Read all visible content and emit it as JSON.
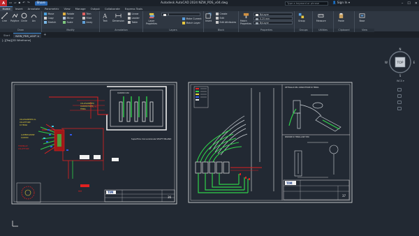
{
  "window": {
    "title": "Autodesk AutoCAD 2024   NZW_PDS_v04.dwg",
    "app_logo": "A",
    "share_label": "Share",
    "search_placeholder": "Type a keyword or phrase",
    "signin_label": "Sign In",
    "controls": [
      "–",
      "☐",
      "✕"
    ]
  },
  "ribbon_tabs": [
    "Home",
    "Insert",
    "Annotate",
    "Parametric",
    "View",
    "Manage",
    "Output",
    "Collaborate",
    "Express Tools"
  ],
  "active_tab": "Home",
  "ribbon": {
    "draw": {
      "title": "Draw",
      "line": "Line",
      "polyline": "Polyline",
      "circle": "Circle",
      "arc": "Arc"
    },
    "modify": {
      "title": "Modify",
      "move": "Move",
      "rotate": "Rotate",
      "trim": "Trim",
      "copy": "Copy",
      "mirror": "Mirror",
      "fillet": "Fillet",
      "stretch": "Stretch",
      "scale": "Scale",
      "array": "Array"
    },
    "annotation": {
      "title": "Annotation",
      "text": "Text",
      "dimension": "Dimension",
      "linear": "Linear",
      "leader": "Leader",
      "table": "Table"
    },
    "layers": {
      "title": "Layers",
      "layer_properties": "Layer Properties",
      "make_current": "Make Current",
      "match_layer": "Match Layer",
      "layer_value": "0"
    },
    "block": {
      "title": "Block",
      "insert": "Insert",
      "create": "Create",
      "edit": "Edit",
      "edit_attributes": "Edit Attributes"
    },
    "properties": {
      "title": "Properties",
      "match_properties": "Match Properties",
      "color_value": "ByLayer",
      "lineweight_value": "0.25 mm",
      "linetype_value": "ByLayer"
    },
    "groups": {
      "title": "Groups",
      "group": "Group"
    },
    "utilities": {
      "title": "Utilities",
      "measure": "Measure"
    },
    "clipboard": {
      "title": "Clipboard",
      "paste": "Paste"
    },
    "view": {
      "title": "View",
      "base": "Base"
    }
  },
  "document_tabs": [
    "Start",
    "NZW_PDS_v04*"
  ],
  "viewport": {
    "label": "[–][Top][2D Wireframe]",
    "viewcube": {
      "center": "TOP",
      "north": "N",
      "south": "S",
      "east": "E",
      "west": "W",
      "wcs": "WCS"
    }
  },
  "sheets": [
    {
      "number": "36",
      "logo": "TIM",
      "annotation": "Superficie Convenzionale SHAFT MILANO"
    },
    {
      "number": "37",
      "logo": "TIM",
      "annotation_top": "DETTAGLIO DEL CONDUTTORE DI TERRA",
      "annotation_mid": "SEZIONE DI TERRA LINE TIPO"
    }
  ],
  "colors": {
    "background": "#222933",
    "ribbon": "#2f3742",
    "accent": "#2e6bb5",
    "cad_red": "#e02020",
    "cad_green": "#2fd14a",
    "cad_white": "#f2f2f2",
    "cad_cyan": "#3fc8e0",
    "cad_yellow": "#e8d23a",
    "cad_blue": "#3058e8"
  }
}
